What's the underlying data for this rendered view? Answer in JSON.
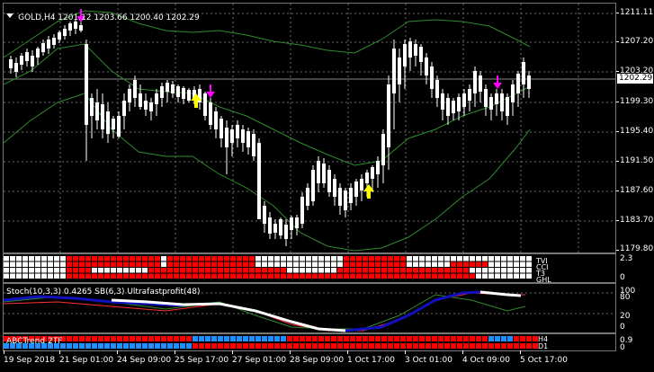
{
  "window": {
    "menu_icon": "triangle-down-icon",
    "title": "GOLD,H4  1201.12 1203.66 1200.40 1202.29"
  },
  "price_axis": {
    "labels": [
      "1211.11",
      "1207.20",
      "1203.20",
      "1199.30",
      "1195.40",
      "1191.50",
      "1187.60",
      "1183.70",
      "1179.80"
    ],
    "current_price": "1202.29"
  },
  "trend_panel": {
    "axis_labels": [
      "2.3",
      "0"
    ],
    "row_labels": [
      "TVI",
      "CCI",
      "T3",
      "GHL"
    ]
  },
  "stoch_panel": {
    "title": "Stoch(10,3,3) 0.4265 SB(6,3) Ultrafastprofit(48)",
    "axis_labels": [
      "100",
      "80",
      "20",
      "0"
    ]
  },
  "abc_panel": {
    "title": "ABCTrend 2TF",
    "axis_labels": [
      "0.9",
      "0"
    ],
    "row_labels": [
      "H4",
      "D1"
    ]
  },
  "time_axis": {
    "labels": [
      "19 Sep 2018",
      "21 Sep 01:00",
      "24 Sep 09:00",
      "25 Sep 17:00",
      "27 Sep 01:00",
      "28 Sep 09:00",
      "1 Oct 17:00",
      "3 Oct 01:00",
      "4 Oct 09:00",
      "5 Oct 17:00"
    ]
  },
  "colors": {
    "background": "#000000",
    "grid": "#6b6b6b",
    "candle": "#ffffff",
    "band": "#2e8b2e",
    "sell_arrow": "#ff00ff",
    "buy_arrow": "#ffff00",
    "trend_red": "#ff0000",
    "trend_white": "#ffffff",
    "abc_blue": "#1e90ff",
    "stoch_blue": "#1010c0"
  }
}
